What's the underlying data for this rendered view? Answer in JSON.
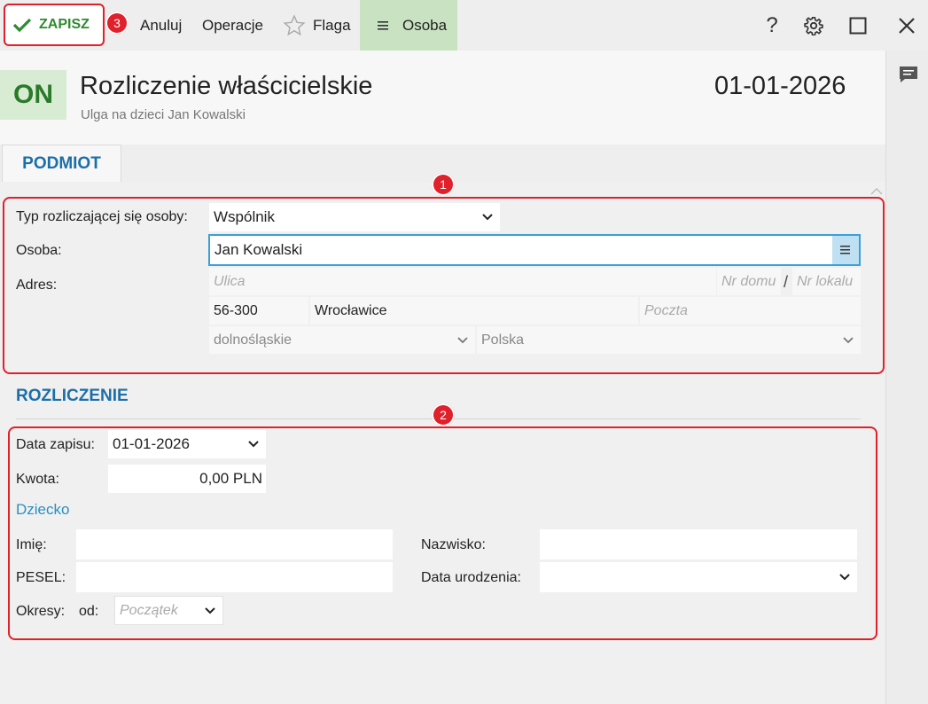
{
  "toolbar": {
    "save_label": "ZAPISZ",
    "save_badge": "3",
    "cancel_label": "Anuluj",
    "operations_label": "Operacje",
    "flag_label": "Flaga",
    "person_label": "Osoba",
    "help_label": "?"
  },
  "header": {
    "status": "ON",
    "title": "Rozliczenie właścicielskie",
    "subtitle": "Ulga na dzieci Jan Kowalski",
    "date": "01-01-2026"
  },
  "tabs": [
    {
      "label": "PODMIOT"
    }
  ],
  "badges": {
    "one": "1",
    "two": "2"
  },
  "podmiot": {
    "type_label": "Typ rozliczającej się osoby:",
    "type_value": "Wspólnik",
    "person_label": "Osoba:",
    "person_value": "Jan Kowalski",
    "address_label": "Adres:",
    "street_placeholder": "Ulica",
    "house_placeholder": "Nr domu",
    "slash": "/",
    "flat_placeholder": "Nr lokalu",
    "postal_code": "56-300",
    "city": "Wrocławice",
    "post_placeholder": "Poczta",
    "province": "dolnośląskie",
    "country": "Polska"
  },
  "rozliczenie": {
    "section_title": "ROZLICZENIE",
    "date_label": "Data zapisu:",
    "date_value": "01-01-2026",
    "amount_label": "Kwota:",
    "amount_value": "0,00 PLN",
    "child_link": "Dziecko",
    "first_name_label": "Imię:",
    "first_name_value": "",
    "last_name_label": "Nazwisko:",
    "last_name_value": "",
    "pesel_label": "PESEL:",
    "pesel_value": "",
    "birth_label": "Data urodzenia:",
    "birth_value": "",
    "periods_label": "Okresy:",
    "from_label": "od:",
    "from_placeholder": "Początek"
  },
  "colors": {
    "accent_blue": "#1b6fa8",
    "save_green": "#2e8b2e",
    "annotation_red": "#e0202a",
    "person_button_bg": "#c9e3c2"
  }
}
